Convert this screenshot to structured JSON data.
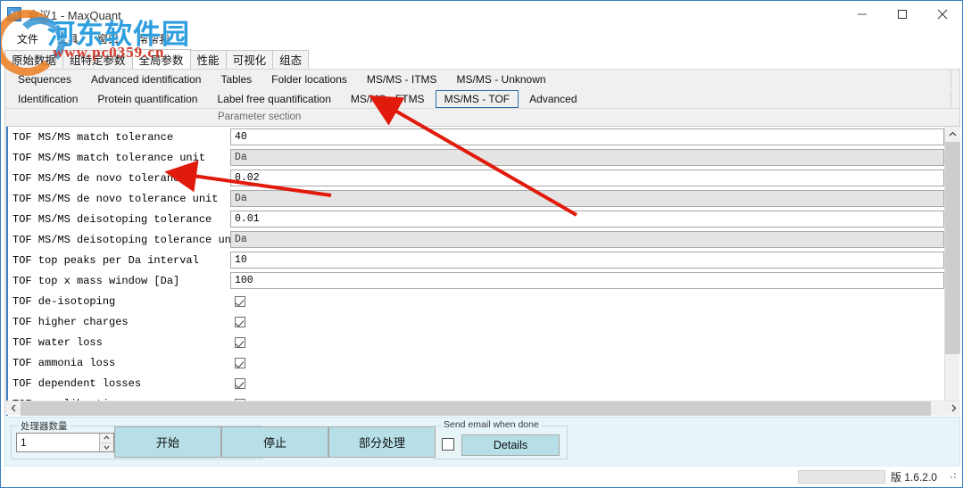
{
  "window": {
    "title": "会议1 - MaxQuant",
    "icon": "maxquant-icon",
    "minimize": "–",
    "maximize": "□",
    "close": "✕"
  },
  "menu": {
    "items": [
      {
        "label": "文件"
      },
      {
        "label": "工具"
      },
      {
        "label": "窗口"
      },
      {
        "label": "帮帮我"
      }
    ]
  },
  "outer_tabs": [
    {
      "label": "原始数据",
      "active": false
    },
    {
      "label": "组特定参数",
      "active": false
    },
    {
      "label": "全局参数",
      "active": true
    },
    {
      "label": "性能",
      "active": false
    },
    {
      "label": "可视化",
      "active": false
    },
    {
      "label": "组态",
      "active": false
    }
  ],
  "inner_tabs_row1": [
    {
      "label": "Sequences"
    },
    {
      "label": "Advanced identification"
    },
    {
      "label": "Tables"
    },
    {
      "label": "Folder locations"
    },
    {
      "label": "MS/MS - ITMS"
    },
    {
      "label": "MS/MS - Unknown"
    }
  ],
  "inner_tabs_row2": [
    {
      "label": "Identification",
      "selected": false
    },
    {
      "label": "Protein quantification",
      "selected": false
    },
    {
      "label": "Label free quantification",
      "selected": false
    },
    {
      "label": "MS/MS - FTMS",
      "selected": false
    },
    {
      "label": "MS/MS - TOF",
      "selected": true
    },
    {
      "label": "Advanced",
      "selected": false
    }
  ],
  "section": {
    "header": "Parameter section"
  },
  "parameters": [
    {
      "label": "TOF MS/MS match tolerance",
      "value": "40",
      "type": "text",
      "readonly": false
    },
    {
      "label": "TOF MS/MS match tolerance unit",
      "value": "Da",
      "type": "text",
      "readonly": true
    },
    {
      "label": "TOF MS/MS de novo tolerance",
      "value": "0.02",
      "type": "text",
      "readonly": false
    },
    {
      "label": "TOF MS/MS de novo tolerance unit",
      "value": "Da",
      "type": "text",
      "readonly": true
    },
    {
      "label": "TOF MS/MS deisotoping tolerance",
      "value": "0.01",
      "type": "text",
      "readonly": false
    },
    {
      "label": "TOF MS/MS deisotoping tolerance unit",
      "value": "Da",
      "type": "text",
      "readonly": true
    },
    {
      "label": "TOF top peaks per Da interval",
      "value": "10",
      "type": "text",
      "readonly": false
    },
    {
      "label": "TOF top x mass window [Da]",
      "value": "100",
      "type": "text",
      "readonly": false
    },
    {
      "label": "TOF de-isotoping",
      "value": "",
      "type": "checkbox",
      "checked": true
    },
    {
      "label": "TOF higher charges",
      "value": "",
      "type": "checkbox",
      "checked": true
    },
    {
      "label": "TOF water loss",
      "value": "",
      "type": "checkbox",
      "checked": true
    },
    {
      "label": "TOF ammonia loss",
      "value": "",
      "type": "checkbox",
      "checked": true
    },
    {
      "label": "TOF dependent losses",
      "value": "",
      "type": "checkbox",
      "checked": true
    },
    {
      "label": "TOF recalibration",
      "value": "",
      "type": "checkbox",
      "checked": false
    }
  ],
  "command_bar": {
    "threads_label": "处理器数量",
    "threads_value": "1",
    "start_label": "开始",
    "stop_label": "停止",
    "partial_label": "部分处理",
    "email_group_label": "Send email when done",
    "details_label": "Details"
  },
  "status_bar": {
    "version": "版 1.6.2.0"
  },
  "watermark": {
    "main": "河东软件园",
    "sub": "www.pc0359.cn"
  },
  "colors": {
    "accent_border": "#3a7dbf",
    "button_fill": "#b6dfe8",
    "bar_bg": "#e7f4f8",
    "selected_tab_border": "#2b6ca8",
    "annotation": "#e01b0c"
  }
}
